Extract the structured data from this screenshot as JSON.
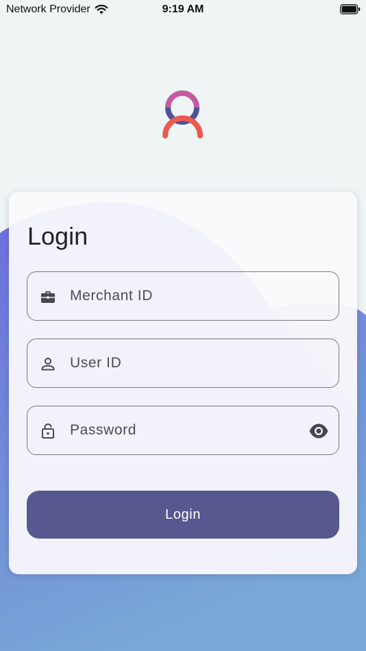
{
  "status_bar": {
    "carrier": "Network Provider",
    "time": "9:19 AM"
  },
  "login": {
    "title": "Login",
    "merchant_field": {
      "placeholder": "Merchant ID",
      "icon": "briefcase-icon"
    },
    "user_field": {
      "placeholder": "User ID",
      "icon": "person-icon"
    },
    "password_field": {
      "placeholder": "Password",
      "icon": "lock-icon",
      "toggle_icon": "eye-icon"
    },
    "button_label": "Login"
  },
  "colors": {
    "background": "#eef5f4",
    "wave_primary": "#6f79db",
    "wave_secondary": "#7aa7d8",
    "button": "#575890",
    "logo_head_top": "#c35aa0",
    "logo_head_bottom": "#4f4f9a",
    "logo_body": "#ea5a4f"
  }
}
